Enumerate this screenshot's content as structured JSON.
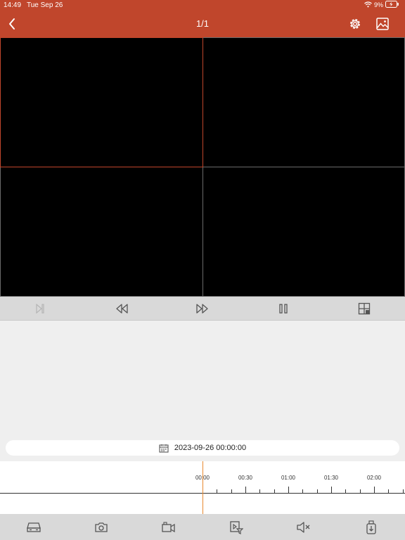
{
  "status_bar": {
    "time": "14:49",
    "date": "Tue Sep 26",
    "battery": "9%"
  },
  "header": {
    "title": "1/1",
    "icons": [
      "back-icon",
      "settings-icon",
      "image-icon"
    ]
  },
  "playback_controls": [
    "step-frame-icon",
    "rewind-icon",
    "fast-forward-icon",
    "pause-icon",
    "layout-grid-icon"
  ],
  "date_selector": {
    "value": "2023-09-26 00:00:00"
  },
  "timeline": {
    "labels": [
      "00:00",
      "00:30",
      "01:00",
      "01:30",
      "02:00"
    ]
  },
  "toolbar": [
    "device-icon",
    "camera-icon",
    "video-record-icon",
    "playback-filter-icon",
    "mute-icon",
    "usb-download-icon"
  ],
  "colors": {
    "accent": "#c0462c",
    "cursor": "#e8892f"
  }
}
